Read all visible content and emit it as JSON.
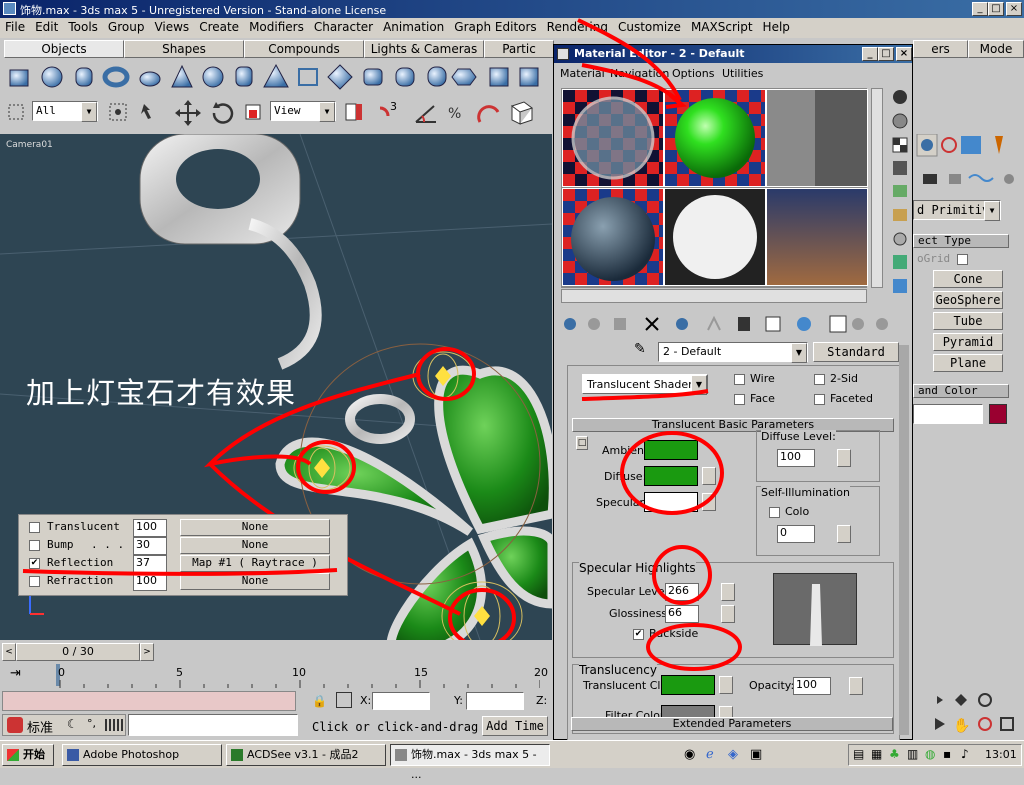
{
  "window": {
    "title": "饰物.max - 3ds max 5 - Unregistered Version - Stand-alone License"
  },
  "menu": [
    "File",
    "Edit",
    "Tools",
    "Group",
    "Views",
    "Create",
    "Modifiers",
    "Character",
    "Animation",
    "Graph Editors",
    "Rendering",
    "Customize",
    "MAXScript",
    "Help"
  ],
  "tabs": [
    "Objects",
    "Shapes",
    "Compounds",
    "Lights & Cameras",
    "Partic",
    "ers",
    "Mode"
  ],
  "toolbar": {
    "selection_filter": "All",
    "coord_system": "View",
    "right_view": "iew"
  },
  "viewport": {
    "label": "Camera01",
    "annotation": "加上灯宝石才有效果"
  },
  "maps": [
    {
      "name": "Translucent",
      "amount": "100",
      "map": "None",
      "checked": false
    },
    {
      "name": "Bump",
      "amount": "30",
      "map": "None",
      "checked": false
    },
    {
      "name": "Reflection",
      "amount": "37",
      "map": "Map #1  ( Raytrace )",
      "checked": true
    },
    {
      "name": "Refraction",
      "amount": "100",
      "map": "None",
      "checked": false
    }
  ],
  "material_editor": {
    "title": "Material Editor - 2 - Default",
    "menu": [
      "Material",
      "Navigation",
      "Options",
      "Utilities"
    ],
    "material_name": "2 - Default",
    "material_type": "Standard",
    "shader": "Translucent Shader",
    "checks": {
      "wire": "Wire",
      "two_sided": "2-Sid",
      "face": "Face",
      "faceted": "Faceted"
    },
    "basic": {
      "header": "Translucent Basic Parameters",
      "ambient": "Ambient:",
      "diffuse": "Diffuse:",
      "specular": "Specular:",
      "diffuse_level_label": "Diffuse Level:",
      "diffuse_level": "100",
      "self_illum_label": "Self-Illumination",
      "color_label": "Colo",
      "self_illum_value": "0"
    },
    "specular_highlights": {
      "header": "Specular Highlights",
      "level_label": "Specular Level:",
      "level": "266",
      "gloss_label": "Glossiness:",
      "gloss": "66",
      "backside_label": "Backside"
    },
    "translucency": {
      "header": "Translucency",
      "clr_label": "Translucent Clr:",
      "opacity_label": "Opacity:",
      "opacity": "100",
      "filter_label": "Filter Color:"
    },
    "extended_header": "Extended Parameters",
    "colors": {
      "green": "#1a9a10",
      "filter": "#7a7a7a"
    }
  },
  "command_panel": {
    "dropdown": "d Primitiv",
    "object_type": "ect Type",
    "autogrid": "oGrid",
    "buttons": [
      "Cone",
      "GeoSphere",
      "Tube",
      "Pyramid",
      "Plane"
    ],
    "name_color": "and Color",
    "color": "#9a0030"
  },
  "timeline": {
    "frame": "0 / 30",
    "ticks": [
      "0",
      "5",
      "10",
      "15",
      "20"
    ]
  },
  "status": {
    "x_label": "X:",
    "y_label": "Y:",
    "z_label": "Z:",
    "prompt": "Click or click-and-drag",
    "add_time": "Add Time",
    "ime": "标准"
  },
  "taskbar": {
    "start": "开始",
    "items": [
      "Adobe Photoshop",
      "ACDSee v3.1 - 成品2",
      "饰物.max - 3ds max 5 - ..."
    ],
    "clock": "13:01"
  }
}
